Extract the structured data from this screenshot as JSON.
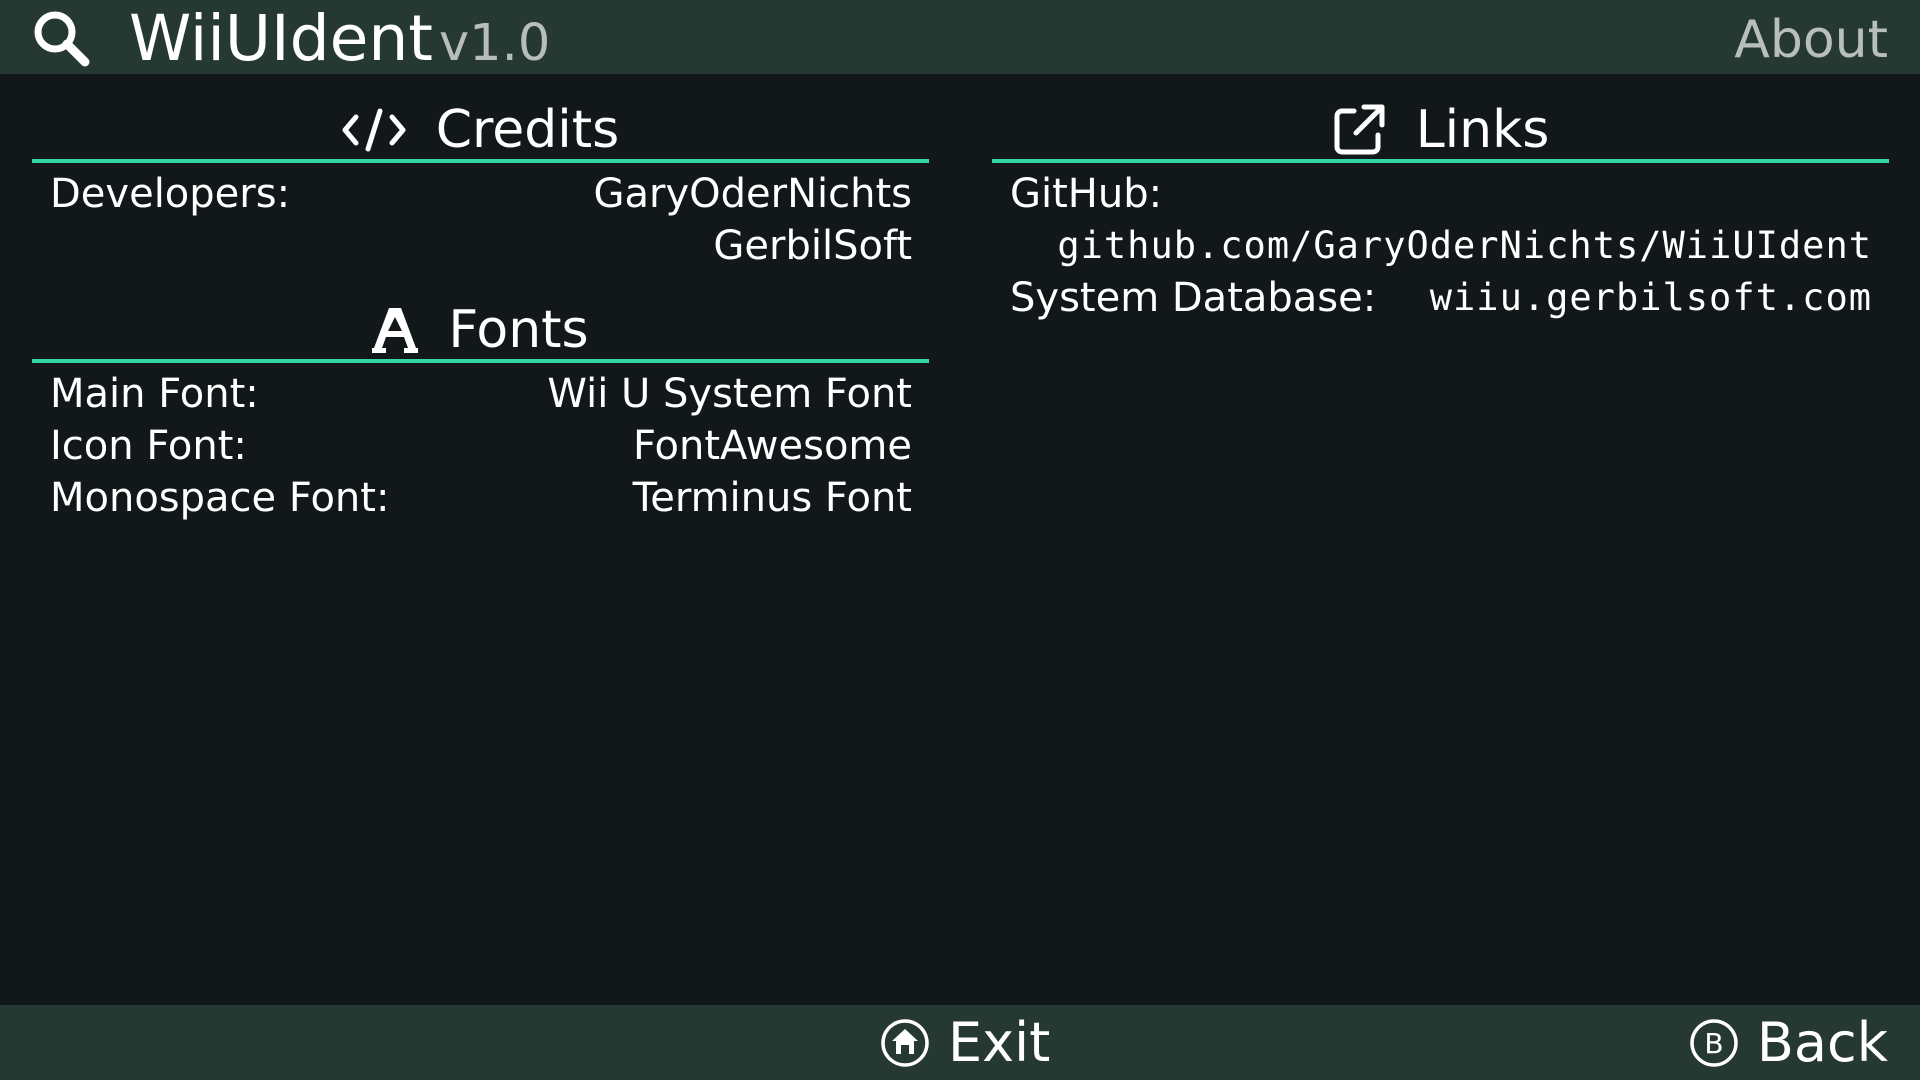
{
  "header": {
    "title": "WiiUIdent",
    "version": "v1.0",
    "about_label": "About",
    "search_icon": "search-icon"
  },
  "credits": {
    "heading": "Credits",
    "icon": "code-icon",
    "developers_label": "Developers:",
    "developers": [
      "GaryOderNichts",
      "GerbilSoft"
    ]
  },
  "fonts": {
    "heading": "Fonts",
    "icon": "font-icon",
    "rows": [
      {
        "label": "Main Font:",
        "value": "Wii U System Font"
      },
      {
        "label": "Icon Font:",
        "value": "FontAwesome"
      },
      {
        "label": "Monospace Font:",
        "value": "Terminus Font"
      }
    ]
  },
  "links": {
    "heading": "Links",
    "icon": "external-link-icon",
    "github_label": "GitHub:",
    "github_url": "github.com/GaryOderNichts/WiiUIdent",
    "db_label": "System Database:",
    "db_url": "wiiu.gerbilsoft.com"
  },
  "footer": {
    "exit_label": "Exit",
    "exit_icon": "home-button-icon",
    "back_label": "Back",
    "back_icon": "b-button-icon"
  },
  "colors": {
    "background": "#121819",
    "bar": "#263832",
    "accent": "#34d6a8",
    "dim_text": "#b8bfbb"
  }
}
